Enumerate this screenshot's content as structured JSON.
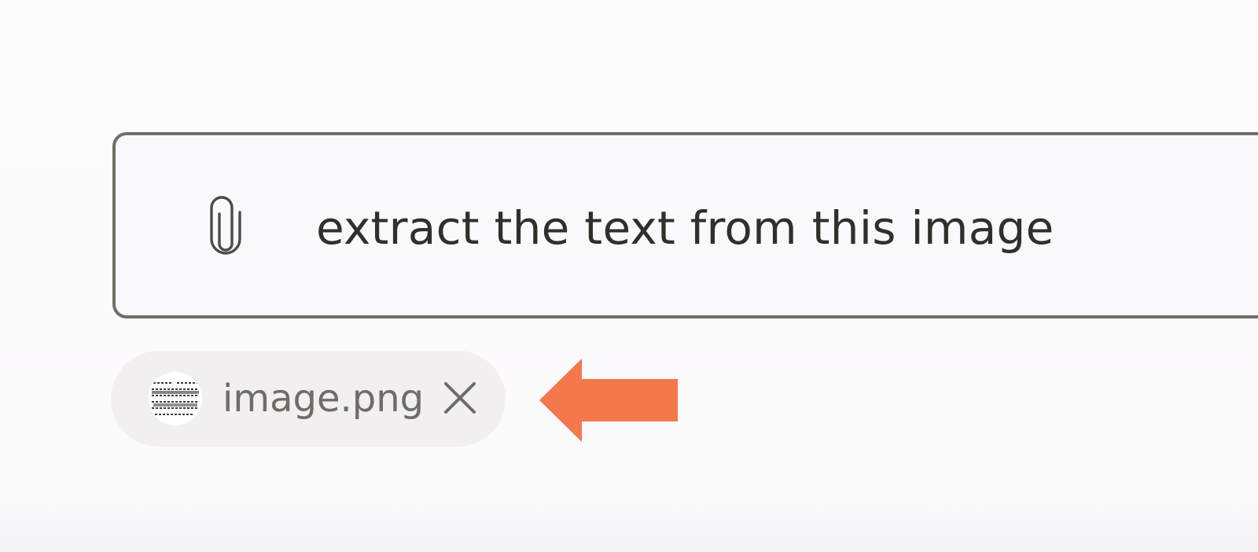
{
  "prompt": {
    "text": "extract the text from this image",
    "attach_icon": "paperclip-icon"
  },
  "attachment": {
    "file_name": "image.png",
    "thumbnail_icon": "image-thumbnail",
    "remove_icon": "close-icon"
  },
  "annotation": {
    "arrow_icon": "left-arrow",
    "arrow_color": "#f4774d"
  },
  "colors": {
    "border": "#716f66",
    "chip_background": "#f1efef",
    "text": "#2f2f2c",
    "muted_text": "#6e6c68"
  }
}
